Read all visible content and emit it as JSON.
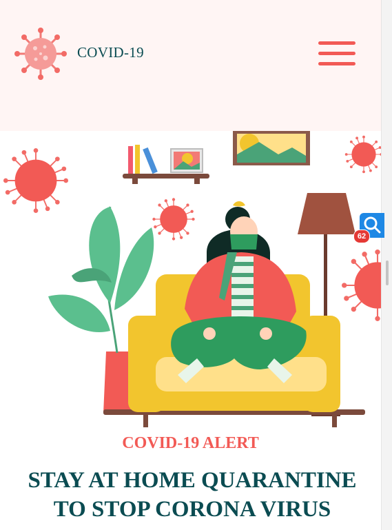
{
  "header": {
    "logo_icon": "coronavirus-icon",
    "brand_name": "COVID-19",
    "menu_icon": "hamburger-menu-icon"
  },
  "hero": {
    "illustration": "woman-quarantine-on-sofa-illustration"
  },
  "content": {
    "alert_label": "COVID-19 ALERT",
    "headline_line1": "STAY AT HOME QUARANTINE",
    "headline_line2": "TO STOP CORONA VIRUS"
  },
  "widget": {
    "icon": "magnifier-icon",
    "badge_count": "62"
  },
  "colors": {
    "header_bg": "#fff5f4",
    "accent": "#f25a55",
    "heading": "#0b4c52",
    "sofa": "#f2c52e",
    "plant": "#5bbf8e"
  }
}
